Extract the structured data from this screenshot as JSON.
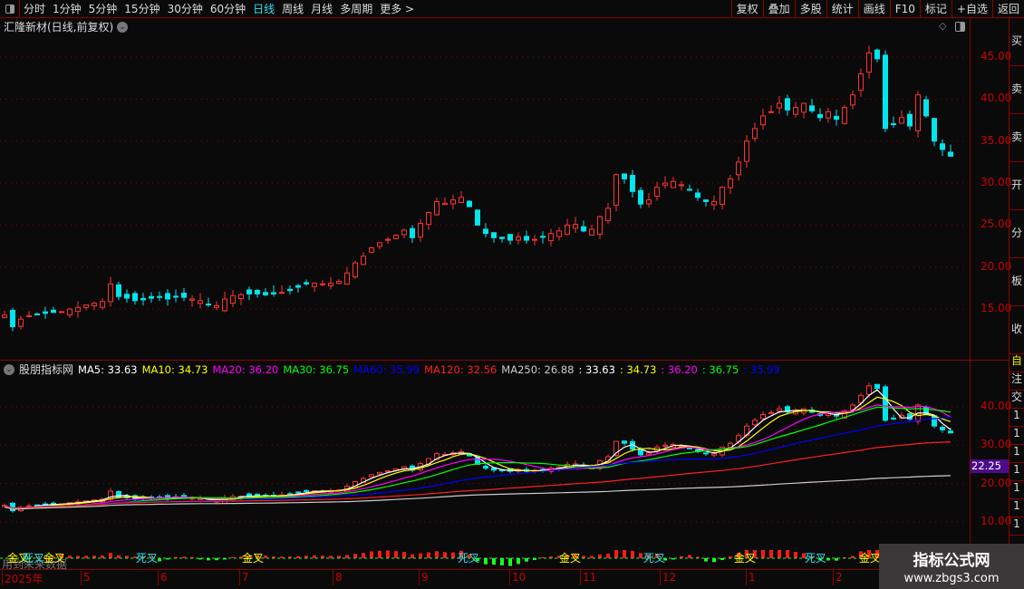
{
  "toolbar": {
    "periods": [
      "分时",
      "1分钟",
      "5分钟",
      "15分钟",
      "30分钟",
      "60分钟",
      "日线",
      "周线",
      "月线",
      "多周期",
      "更多 >"
    ],
    "active_period": "日线",
    "buttons": [
      "复权",
      "叠加",
      "多股",
      "统计",
      "画线",
      "F10",
      "标记",
      "+自选",
      "返回"
    ]
  },
  "main": {
    "title": "汇隆新材(日线,前复权)",
    "y_ticks": [
      "45.00",
      "40.00",
      "35.00",
      "30.00",
      "25.00",
      "20.00",
      "15.00"
    ]
  },
  "indicator": {
    "name": "股朋指标网",
    "ma_items": [
      {
        "label": "MA5: 33.63",
        "color": "#ffffff"
      },
      {
        "label": "MA10: 34.73",
        "color": "#ffff00"
      },
      {
        "label": "MA20: 36.20",
        "color": "#ff00ff"
      },
      {
        "label": "MA30: 36.75",
        "color": "#00ff00"
      },
      {
        "label": "MA60: 35.99",
        "color": "#0000ff"
      },
      {
        "label": "MA120: 32.56",
        "color": "#ff2020"
      },
      {
        "label": "MA250: 26.88",
        "color": "#cccccc"
      },
      {
        "label": ": 33.63",
        "color": "#ffffff"
      },
      {
        "label": ": 34.73",
        "color": "#ffff00"
      },
      {
        "label": ": 36.20",
        "color": "#ff00ff"
      },
      {
        "label": ": 36.75",
        "color": "#00ff00"
      },
      {
        "label": ": 35.99",
        "color": "#0000ff"
      }
    ],
    "y_ticks": [
      "40.00",
      "30.00",
      "20.00",
      "10.00"
    ],
    "current_price": "22.25",
    "future_data_note": "用到未来数据",
    "signals": [
      {
        "label": "金叉",
        "type": "golden"
      },
      {
        "label": "死叉",
        "type": "death"
      },
      {
        "label": "金叉",
        "type": "golden"
      },
      {
        "label": "死叉",
        "type": "death"
      },
      {
        "label": "金叉",
        "type": "golden"
      },
      {
        "label": "死叉",
        "type": "death"
      },
      {
        "label": "金叉",
        "type": "golden"
      },
      {
        "label": "死叉",
        "type": "death"
      },
      {
        "label": "金叉",
        "type": "golden"
      },
      {
        "label": "死叉",
        "type": "death"
      },
      {
        "label": "金叉",
        "type": "golden"
      }
    ]
  },
  "time_axis": [
    "2025年",
    "5",
    "6",
    "7",
    "8",
    "9",
    "10",
    "11",
    "12",
    "1",
    "2"
  ],
  "right_strip": {
    "tabs_top": [
      "买",
      "卖",
      "卖",
      "开",
      "分",
      "板",
      "收"
    ],
    "tabs_bottom": [
      "自",
      "注",
      "交",
      "1",
      "1",
      "1",
      "1",
      "1",
      "1",
      "1"
    ]
  },
  "watermark": {
    "name": "指标公式网",
    "url": "www.zbgs3.com"
  },
  "colors": {
    "up": "#ff3232",
    "down": "#00e5ee",
    "axis": "#cc0000",
    "grid": "#8b0000",
    "active": "#2be0f0"
  },
  "chart_data": {
    "type": "candlestick",
    "y_range": [
      11,
      48
    ],
    "closes": [
      14.3,
      12.9,
      13.8,
      14.2,
      14.4,
      14.5,
      14.6,
      14.7,
      15.0,
      15.2,
      15.5,
      15.7,
      15.9,
      18.0,
      16.5,
      16.3,
      16.0,
      16.1,
      16.3,
      16.4,
      16.2,
      16.5,
      16.4,
      16.2,
      16.0,
      15.5,
      15.4,
      16.2,
      16.6,
      16.7,
      16.8,
      16.8,
      16.7,
      16.8,
      17.0,
      17.2,
      17.6,
      18.0,
      18.1,
      18.0,
      18.1,
      18.3,
      19.3,
      20.5,
      21.3,
      22.3,
      22.9,
      23.3,
      23.8,
      24.4,
      23.5,
      25.2,
      26.5,
      27.8,
      27.6,
      28.0,
      28.3,
      27.2,
      25.0,
      24.0,
      23.5,
      23.4,
      23.2,
      23.6,
      23.2,
      23.3,
      23.6,
      24.0,
      24.3,
      25.0,
      25.1,
      24.3,
      24.5,
      26.0,
      27.0,
      31.0,
      30.5,
      29.0,
      27.5,
      28.0,
      29.5,
      30.0,
      30.2,
      29.8,
      29.2,
      28.3,
      27.8,
      27.8,
      29.5,
      30.5,
      32.5,
      35.0,
      36.5,
      38.0,
      38.5,
      39.5,
      38.7,
      39.0,
      39.5,
      38.6,
      37.8,
      38.5,
      37.6,
      39.0,
      40.5,
      43.0,
      45.5,
      44.8,
      36.5,
      37.0,
      37.8,
      36.8,
      40.5,
      38.0,
      35.0,
      34.0,
      33.2
    ]
  }
}
